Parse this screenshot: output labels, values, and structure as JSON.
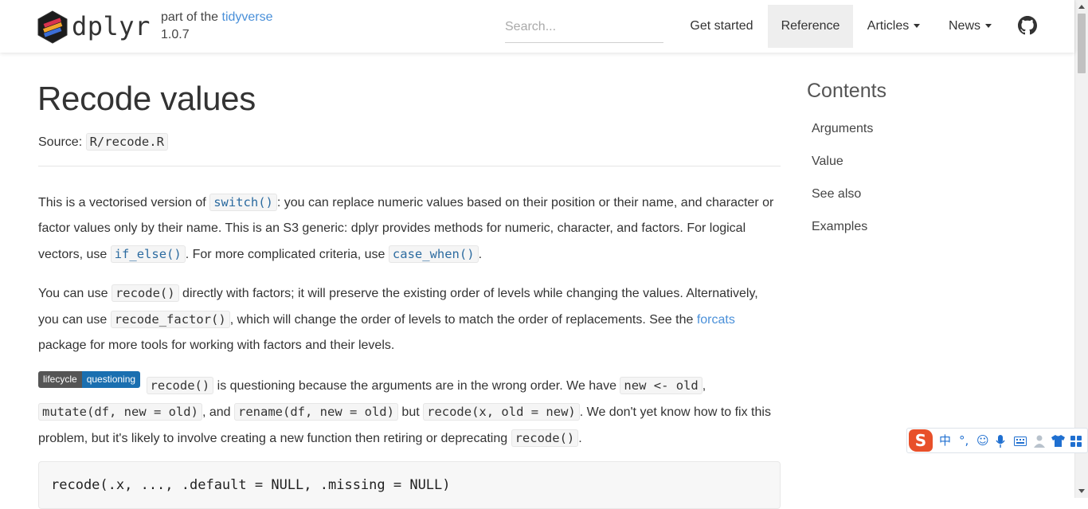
{
  "navbar": {
    "brand": "dplyr",
    "tagline_prefix": "part of the",
    "tagline_link": "tidyverse",
    "version": "1.0.7",
    "search_placeholder": "Search...",
    "items": [
      {
        "label": "Get started"
      },
      {
        "label": "Reference"
      },
      {
        "label": "Articles"
      },
      {
        "label": "News"
      }
    ],
    "github_icon": "github-icon"
  },
  "page": {
    "title": "Recode values",
    "source_label": "Source:",
    "source_file": "R/recode.R"
  },
  "paragraphs": {
    "p1": {
      "t1": "This is a vectorised version of ",
      "c1": "switch()",
      "t2": ": you can replace numeric values based on their position or their name, and character or factor values only by their name. This is an S3 generic: dplyr provides methods for numeric, character, and factors. For logical vectors, use ",
      "c2": "if_else()",
      "t3": ". For more complicated criteria, use ",
      "c3": "case_when()",
      "t4": "."
    },
    "p2": {
      "t1": "You can use ",
      "c1": "recode()",
      "t2": " directly with factors; it will preserve the existing order of levels while changing the values. Alternatively, you can use ",
      "c2": "recode_factor()",
      "t3": ", which will change the order of levels to match the order of replacements. See the ",
      "link": "forcats",
      "t4": " package for more tools for working with factors and their levels."
    },
    "p3": {
      "badge_left": "lifecycle",
      "badge_right": "questioning",
      "c1": "recode()",
      "t1": " is questioning because the arguments are in the wrong order. We have ",
      "c2": "new <- old",
      "t2": ", ",
      "c3": "mutate(df, new = old)",
      "t3": ", and ",
      "c4": "rename(df, new = old)",
      "t4": " but ",
      "c5": "recode(x, old = new)",
      "t5": ". We don't yet know how to fix this problem, but it's likely to involve creating a new function then retiring or deprecating ",
      "c6": "recode()",
      "t6": "."
    }
  },
  "usage": {
    "code": "recode(.x, ..., .default = NULL, .missing = NULL)"
  },
  "toc": {
    "title": "Contents",
    "items": [
      "Arguments",
      "Value",
      "See also",
      "Examples"
    ]
  },
  "ime": {
    "logo": "S",
    "icons": [
      "中",
      "°,",
      "☺",
      "mic-icon",
      "keyboard-icon",
      "person-icon",
      "shirt-icon",
      "grid-icon"
    ]
  },
  "colors": {
    "link": "#4a90d9",
    "code_link": "#2c6ba0",
    "badge_dark": "#555555",
    "badge_blue": "#1a6fb0",
    "active_nav_bg": "#eeeeee"
  }
}
